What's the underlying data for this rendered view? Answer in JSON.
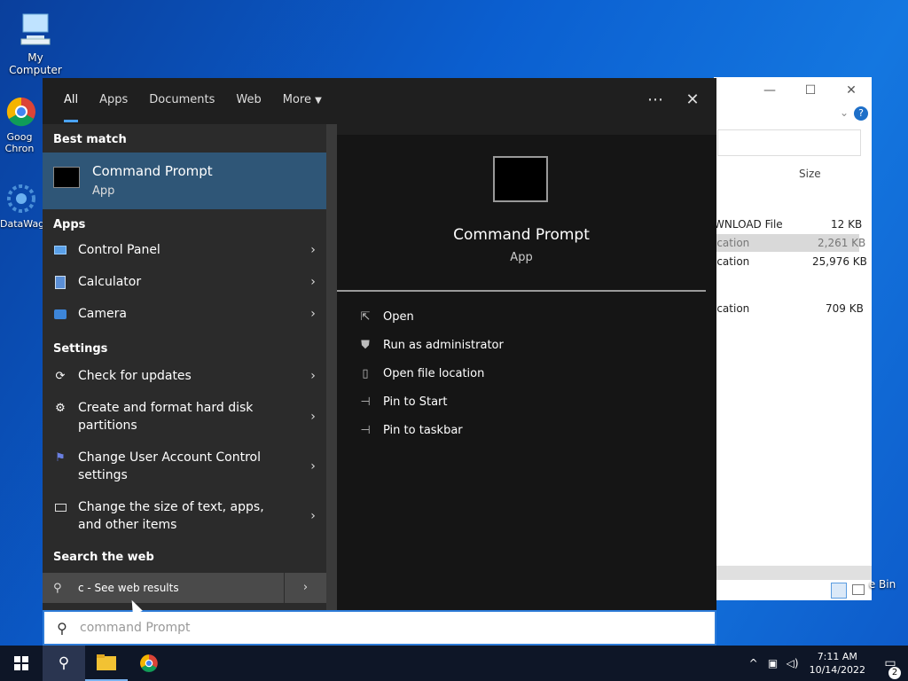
{
  "desktop": {
    "icons": [
      {
        "label": "My Computer"
      },
      {
        "label": "Goog Chron"
      },
      {
        "label": "DataWag"
      }
    ],
    "recycle_label": "e Bin"
  },
  "explorer": {
    "size_header": "Size",
    "rows": [
      {
        "type": "WNLOAD File",
        "size": "12 KB"
      },
      {
        "type": "ication",
        "size": "2,261 KB"
      },
      {
        "type": "ication",
        "size": "25,976 KB"
      },
      {
        "type": "ication",
        "size": "709 KB"
      }
    ]
  },
  "search": {
    "tabs": [
      {
        "label": "All"
      },
      {
        "label": "Apps"
      },
      {
        "label": "Documents"
      },
      {
        "label": "Web"
      },
      {
        "label": "More"
      }
    ],
    "more_icon": "ellipsis-icon",
    "sections": {
      "best_match": "Best match",
      "apps": "Apps",
      "settings": "Settings",
      "web": "Search the web"
    },
    "best_match": {
      "title": "Command Prompt",
      "subtitle": "App"
    },
    "apps": [
      {
        "label": "Control Panel",
        "icon": "control-panel-icon"
      },
      {
        "label": "Calculator",
        "icon": "calculator-icon"
      },
      {
        "label": "Camera",
        "icon": "camera-icon"
      }
    ],
    "settings": [
      {
        "label": "Check for updates",
        "icon": "refresh-icon"
      },
      {
        "label": "Create and format hard disk partitions",
        "icon": "disk-icon"
      },
      {
        "label": "Change User Account Control settings",
        "icon": "flag-icon"
      },
      {
        "label": "Change the size of text, apps, and other items",
        "icon": "monitor-icon"
      }
    ],
    "web_result": {
      "label": "c - See web results"
    },
    "detail": {
      "title": "Command Prompt",
      "subtitle": "App"
    },
    "actions": [
      {
        "label": "Open",
        "icon": "open-icon"
      },
      {
        "label": "Run as administrator",
        "icon": "admin-icon"
      },
      {
        "label": "Open file location",
        "icon": "folder-icon"
      },
      {
        "label": "Pin to Start",
        "icon": "pin-icon"
      },
      {
        "label": "Pin to taskbar",
        "icon": "pin-icon"
      }
    ],
    "query": "command Prompt"
  },
  "taskbar": {
    "time": "7:11 AM",
    "date": "10/14/2022",
    "notifications": "2"
  }
}
